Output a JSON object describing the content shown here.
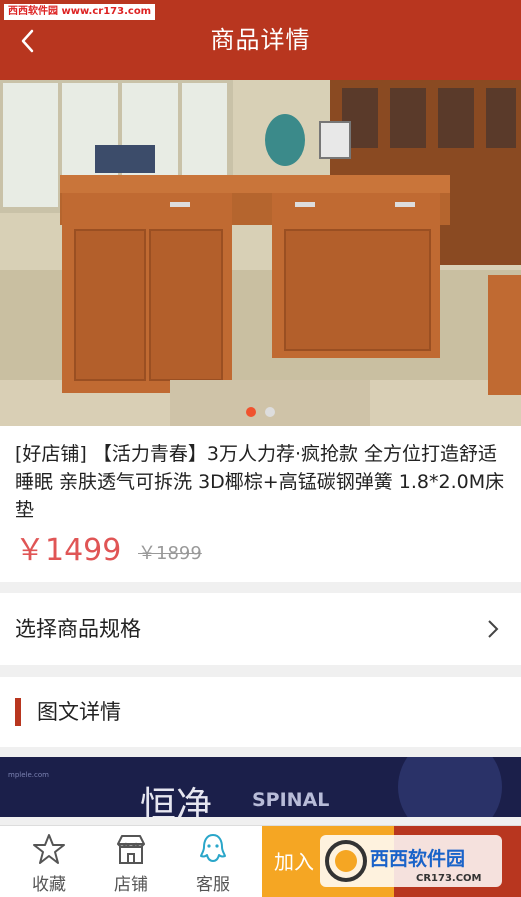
{
  "watermark_top": "西西软件园 www.cr173.com",
  "header": {
    "title": "商品详情"
  },
  "product": {
    "title": "[好店铺] 【活力青春】3万人力荐·疯抢款 全方位打造舒适睡眠 亲肤透气可拆洗 3D椰棕+高锰碳钢弹簧 1.8*2.0M床垫",
    "price": "￥1499",
    "original_price": "￥1899",
    "image_count": 2,
    "active_image_index": 0
  },
  "spec": {
    "label": "选择商品规格"
  },
  "detail": {
    "label": "图文详情"
  },
  "banner": {
    "text_main": "恒净",
    "text_spinal": "SPINAL",
    "small_text": "mplele.com"
  },
  "bottom_bar": {
    "tabs": [
      {
        "label": "收藏",
        "icon": "star-icon"
      },
      {
        "label": "店铺",
        "icon": "store-icon"
      },
      {
        "label": "客服",
        "icon": "customer-service-icon"
      }
    ],
    "add_to_cart_label": "加入",
    "watermark": {
      "brand": "西西软件园",
      "url": "CR173.COM"
    }
  },
  "colors": {
    "primary": "#b8361f",
    "price": "#e05555",
    "accent": "#f5a623",
    "service_icon": "#2aa6c9",
    "dot_active": "#f0522e",
    "dot_inactive": "#dddddd"
  }
}
